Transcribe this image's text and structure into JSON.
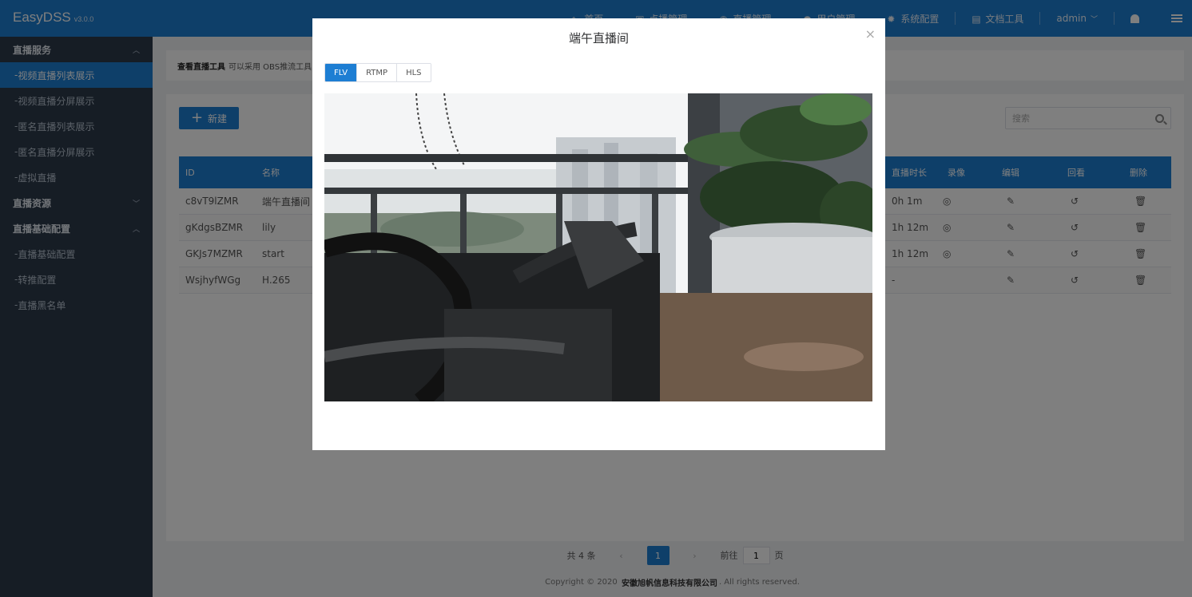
{
  "app": {
    "name": "EasyDSS",
    "version": "v3.0.0"
  },
  "topnav": {
    "items": [
      {
        "label": "首页",
        "icon": "home-icon"
      },
      {
        "label": "点播管理",
        "icon": "video-icon"
      },
      {
        "label": "直播管理",
        "icon": "broadcast-icon"
      },
      {
        "label": "用户管理",
        "icon": "user-icon"
      },
      {
        "label": "系统配置",
        "icon": "gear-icon"
      },
      {
        "label": "文档工具",
        "icon": "doc-icon"
      }
    ],
    "user": "admin"
  },
  "sidebar": {
    "groups": [
      {
        "label": "直播服务",
        "items": [
          "视频直播列表展示",
          "视频直播分屏展示",
          "匿名直播列表展示",
          "匿名直播分屏展示",
          "虚拟直播"
        ]
      },
      {
        "label": "直播资源",
        "items": []
      },
      {
        "label": "直播基础配置",
        "items": [
          "直播基础配置",
          "转推配置",
          "直播黑名单"
        ]
      }
    ],
    "active": "视频直播列表展示"
  },
  "breadcrumb": {
    "strong": "查看直播工具",
    "rest": "可以采用 OBS推流工具 ..."
  },
  "toolbar": {
    "new_label": "新建",
    "search_placeholder": "搜索"
  },
  "table": {
    "headers": {
      "id": "ID",
      "name": "名称",
      "duration": "直播时长",
      "record": "录像",
      "edit": "编辑",
      "playback": "回看",
      "delete": "删除"
    },
    "rows": [
      {
        "id": "c8vT9lZMR",
        "name": "端午直播间",
        "duration": "0h 1m"
      },
      {
        "id": "gKdgsBZMR",
        "name": "lily",
        "duration": "1h 12m"
      },
      {
        "id": "GKJs7MZMR",
        "name": "start",
        "duration": "1h 12m"
      },
      {
        "id": "WsjhyfWGg",
        "name": "H.265",
        "duration": "-"
      }
    ]
  },
  "pagination": {
    "total_text": "共 4 条",
    "current": "1",
    "goto_label": "前往",
    "goto_value": "1",
    "page_unit": "页"
  },
  "footer": {
    "prefix": "Copyright © 2020",
    "company": "安徽旭帆信息科技有限公司",
    "suffix": ". All rights reserved."
  },
  "modal": {
    "title": "端午直播间",
    "close": "×",
    "tabs": [
      "FLV",
      "RTMP",
      "HLS"
    ],
    "active_tab": "FLV"
  },
  "colors": {
    "primary": "#1d7ed3",
    "sidebar_bg": "#2d3a4b"
  }
}
